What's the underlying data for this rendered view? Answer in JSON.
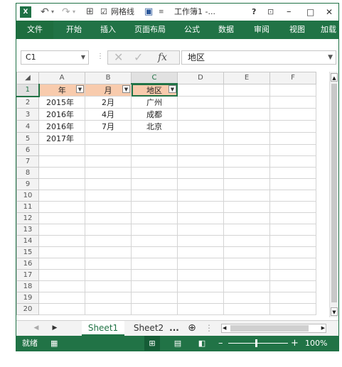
{
  "titlebar": {
    "app_icon": "X",
    "gridlines_label": "网格线",
    "title": "工作簿1 -...",
    "help": "?",
    "minimize": "–",
    "maximize": "□",
    "close": "✕"
  },
  "ribbon": {
    "tabs": [
      "文件",
      "开始",
      "插入",
      "页面布局",
      "公式",
      "数据",
      "审阅",
      "视图",
      "加载"
    ]
  },
  "formula_bar": {
    "name_box": "C1",
    "fx": "fx",
    "content": "地区"
  },
  "sheet": {
    "columns": [
      "A",
      "B",
      "C",
      "D",
      "E",
      "F"
    ],
    "rows": [
      [
        "年",
        "月",
        "地区",
        "",
        "",
        ""
      ],
      [
        "2015年",
        "2月",
        "广州",
        "",
        "",
        ""
      ],
      [
        "2016年",
        "4月",
        "成都",
        "",
        "",
        ""
      ],
      [
        "2016年",
        "7月",
        "北京",
        "",
        "",
        ""
      ],
      [
        "2017年",
        "",
        "",
        "",
        "",
        ""
      ],
      [
        "",
        "",
        "",
        "",
        "",
        ""
      ],
      [
        "",
        "",
        "",
        "",
        "",
        ""
      ],
      [
        "",
        "",
        "",
        "",
        "",
        ""
      ],
      [
        "",
        "",
        "",
        "",
        "",
        ""
      ],
      [
        "",
        "",
        "",
        "",
        "",
        ""
      ],
      [
        "",
        "",
        "",
        "",
        "",
        ""
      ],
      [
        "",
        "",
        "",
        "",
        "",
        ""
      ],
      [
        "",
        "",
        "",
        "",
        "",
        ""
      ],
      [
        "",
        "",
        "",
        "",
        "",
        ""
      ],
      [
        "",
        "",
        "",
        "",
        "",
        ""
      ],
      [
        "",
        "",
        "",
        "",
        "",
        ""
      ],
      [
        "",
        "",
        "",
        "",
        "",
        ""
      ],
      [
        "",
        "",
        "",
        "",
        "",
        ""
      ],
      [
        "",
        "",
        "",
        "",
        "",
        ""
      ],
      [
        "",
        "",
        "",
        "",
        "",
        ""
      ]
    ]
  },
  "sheet_tabs": {
    "tabs": [
      "Sheet1",
      "Sheet2",
      "..."
    ],
    "active": "Sheet1",
    "add": "⊕"
  },
  "status": {
    "ready": "就绪",
    "zoom": "100%",
    "minus": "–",
    "plus": "+"
  }
}
